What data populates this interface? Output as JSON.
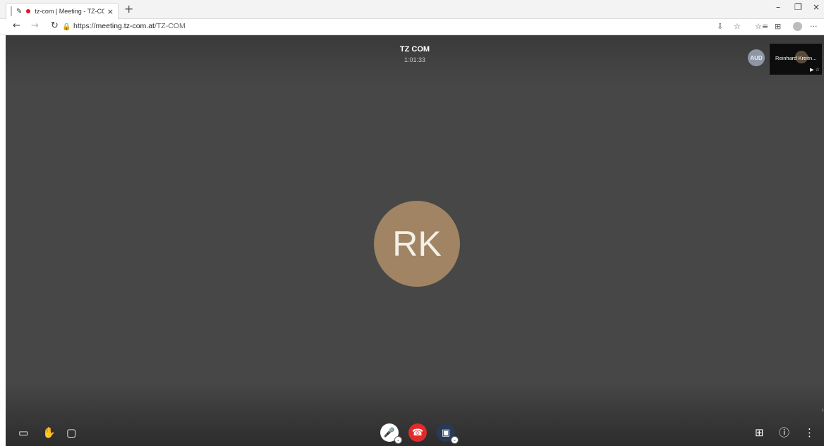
{
  "browser": {
    "tab": {
      "title": "tz-com | Meeting - TZ-COM",
      "close": "×",
      "pin_glyph": "✎"
    },
    "new_tab": "+",
    "window_controls": {
      "minimize": "–",
      "restore": "❐",
      "close": "×"
    },
    "nav": {
      "back": "←",
      "forward": "→",
      "refresh": "↻",
      "lock": "🔒"
    },
    "url": {
      "scheme": "https://",
      "host": "meeting.tz-com.at",
      "path": "/TZ-COM"
    },
    "right_icons": {
      "read_aloud": "⇩",
      "favorite": "☆",
      "favorites": "☆≡",
      "collections": "⊞",
      "more": "···"
    }
  },
  "meeting": {
    "title": "TZ COM",
    "timer": "1:01:33",
    "main_participant_initials": "RK",
    "remote_thumb_initials": "AUD",
    "local_tile": {
      "name": "Reinhard Kreitn...",
      "icons": "▶ ☆"
    }
  },
  "toolbar": {
    "screenshare": "▭",
    "raise_hand": "✋",
    "chat": "▢",
    "mic": "🎤",
    "hangup": "☎",
    "camera": "▣",
    "settings_chevron": "⌄",
    "tile_view": "⊞",
    "info": "ⓘ",
    "more": "⋮",
    "side_chevron": "›"
  },
  "colors": {
    "stage": "#474747",
    "avatar": "#a08463",
    "hangup": "#e32a2a",
    "camera_button": "#273a56"
  }
}
